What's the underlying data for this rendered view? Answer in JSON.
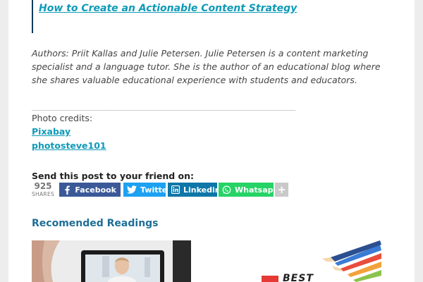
{
  "article": {
    "quote_link": "How to Create an Actionable Content Strategy",
    "authors_text": "Authors: Priit Kallas and Julie Petersen. Julie Petersen is a content marketing specialist and a language tutor. She is the author of an educational blog where she shares valuable educational experience with students and educators.",
    "separator": "______________________________________________________",
    "photo_credits_label": "Photo credits:",
    "credits": [
      "Pixabay",
      "photosteve101"
    ]
  },
  "share": {
    "title": "Send this post to your friend on:",
    "count": "925",
    "count_label": "SHARES",
    "buttons": [
      {
        "label": "Facebook",
        "icon": "facebook-icon",
        "color": "#3b5998"
      },
      {
        "label": "Twitter",
        "icon": "twitter-icon",
        "color": "#1da1f2"
      },
      {
        "label": "Linkedin",
        "icon": "linkedin-icon",
        "color": "#0e76a8"
      },
      {
        "label": "Whatsapp",
        "icon": "whatsapp-icon",
        "color": "#25d366"
      }
    ],
    "more_icon": "plus-icon"
  },
  "recommended": {
    "title": "Recomended Readings",
    "thumb2_text": "BEST"
  },
  "colors": {
    "link": "#0e9ab7",
    "heading": "#1f6e97",
    "background": "#ededed"
  }
}
